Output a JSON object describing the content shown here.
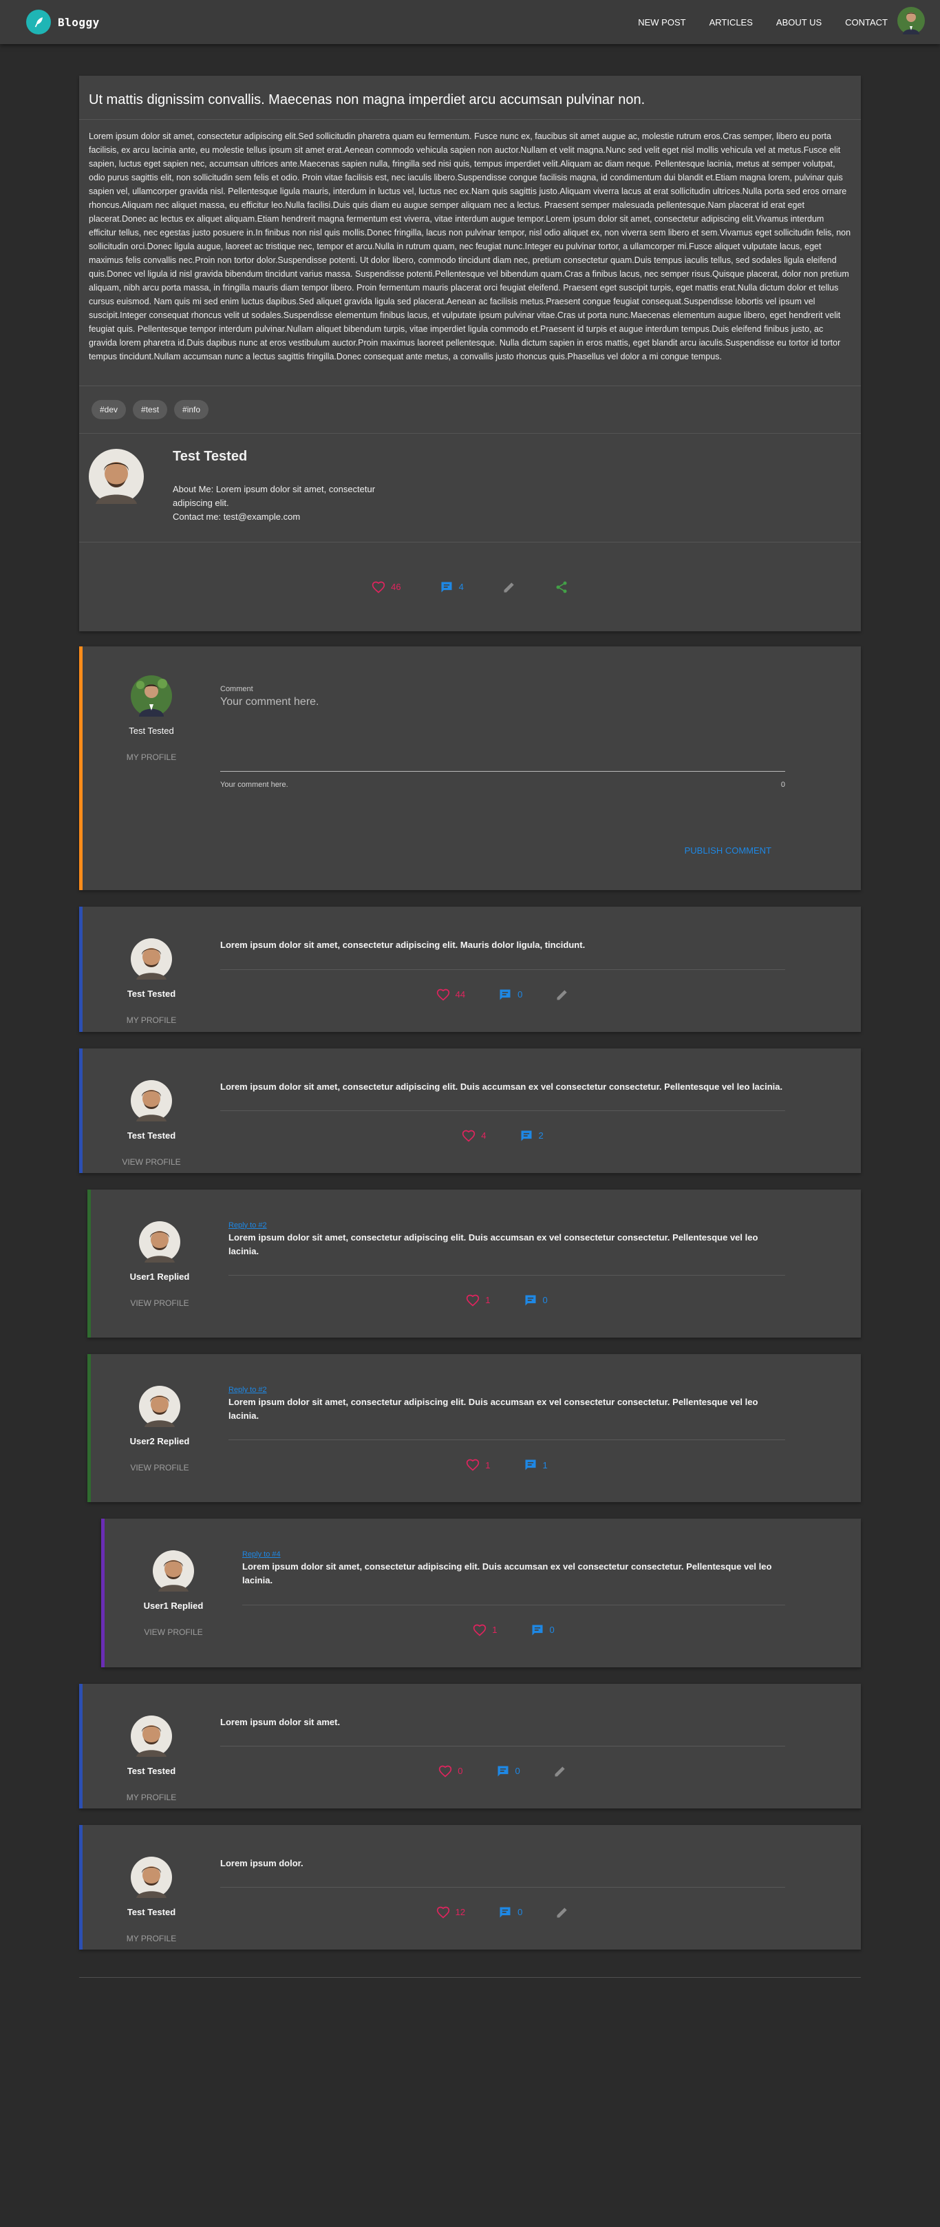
{
  "header": {
    "brand": "Bloggy",
    "nav": [
      "NEW POST",
      "ARTICLES",
      "ABOUT US",
      "CONTACT"
    ]
  },
  "article": {
    "title": "Ut mattis dignissim convallis. Maecenas non magna imperdiet arcu accumsan pulvinar non.",
    "body": "Lorem ipsum dolor sit amet, consectetur adipiscing elit.Sed sollicitudin pharetra quam eu fermentum. Fusce nunc ex, faucibus sit amet augue ac, molestie rutrum eros.Cras semper, libero eu porta facilisis, ex arcu lacinia ante, eu molestie tellus ipsum sit amet erat.Aenean commodo vehicula sapien non auctor.Nullam et velit magna.Nunc sed velit eget nisl mollis vehicula vel at metus.Fusce elit sapien, luctus eget sapien nec, accumsan ultrices ante.Maecenas sapien nulla, fringilla sed nisi quis, tempus imperdiet velit.Aliquam ac diam neque. Pellentesque lacinia, metus at semper volutpat, odio purus sagittis elit, non sollicitudin sem felis et odio. Proin vitae facilisis est, nec iaculis libero.Suspendisse congue facilisis magna, id condimentum dui blandit et.Etiam magna lorem, pulvinar quis sapien vel, ullamcorper gravida nisl. Pellentesque ligula mauris, interdum in luctus vel, luctus nec ex.Nam quis sagittis justo.Aliquam viverra lacus at erat sollicitudin ultrices.Nulla porta sed eros ornare rhoncus.Aliquam nec aliquet massa, eu efficitur leo.Nulla facilisi.Duis quis diam eu augue semper aliquam nec a lectus. Praesent semper malesuada pellentesque.Nam placerat id erat eget placerat.Donec ac lectus ex aliquet aliquam.Etiam hendrerit magna fermentum est viverra, vitae interdum augue tempor.Lorem ipsum dolor sit amet, consectetur adipiscing elit.Vivamus interdum efficitur tellus, nec egestas justo posuere in.In finibus non nisl quis mollis.Donec fringilla, lacus non pulvinar tempor, nisl odio aliquet ex, non viverra sem libero et sem.Vivamus eget sollicitudin felis, non sollicitudin orci.Donec ligula augue, laoreet ac tristique nec, tempor et arcu.Nulla in rutrum quam, nec feugiat nunc.Integer eu pulvinar tortor, a ullamcorper mi.Fusce aliquet vulputate lacus, eget maximus felis convallis nec.Proin non tortor dolor.Suspendisse potenti. Ut dolor libero, commodo tincidunt diam nec, pretium consectetur quam.Duis tempus iaculis tellus, sed sodales ligula eleifend quis.Donec vel ligula id nisl gravida bibendum tincidunt varius massa. Suspendisse potenti.Pellentesque vel bibendum quam.Cras a finibus lacus, nec semper risus.Quisque placerat, dolor non pretium aliquam, nibh arcu porta massa, in fringilla mauris diam tempor libero. Proin fermentum mauris placerat orci feugiat eleifend. Praesent eget suscipit turpis, eget mattis erat.Nulla dictum dolor et tellus cursus euismod. Nam quis mi sed enim luctus dapibus.Sed aliquet gravida ligula sed placerat.Aenean ac facilisis metus.Praesent congue feugiat consequat.Suspendisse lobortis vel ipsum vel suscipit.Integer consequat rhoncus velit ut sodales.Suspendisse elementum finibus lacus, et vulputate ipsum pulvinar vitae.Cras ut porta nunc.Maecenas elementum augue libero, eget hendrerit velit feugiat quis. Pellentesque tempor interdum pulvinar.Nullam aliquet bibendum turpis, vitae imperdiet ligula commodo et.Praesent id turpis et augue interdum tempus.Duis eleifend finibus justo, ac gravida lorem pharetra id.Duis dapibus nunc at eros vestibulum auctor.Proin maximus laoreet pellentesque. Nulla dictum sapien in eros mattis, eget blandit arcu iaculis.Suspendisse eu tortor id tortor tempus tincidunt.Nullam accumsan nunc a lectus sagittis fringilla.Donec consequat ante metus, a convallis justo rhoncus quis.Phasellus vel dolor a mi congue tempus.",
    "tags": [
      "#dev",
      "#test",
      "#info"
    ],
    "author": {
      "name": "Test Tested",
      "about": "About Me: Lorem ipsum dolor sit amet, consectetur adipiscing elit.",
      "contact": "Contact me: test@example.com"
    },
    "likes": "46",
    "comments": "4"
  },
  "comment_form": {
    "user": "Test Tested",
    "profile_link": "MY PROFILE",
    "label": "Comment",
    "placeholder": "Your comment here.",
    "hint": "Your comment here.",
    "counter": "0",
    "publish": "PUBLISH COMMENT"
  },
  "comments": [
    {
      "user": "Test Tested",
      "link": "MY PROFILE",
      "reply_to": "",
      "text": "Lorem ipsum dolor sit amet, consectetur adipiscing elit. Mauris dolor ligula, tincidunt.",
      "likes": "44",
      "replies": "0",
      "editable": true,
      "level": 0
    },
    {
      "user": "Test Tested",
      "link": "VIEW PROFILE",
      "reply_to": "",
      "text": "Lorem ipsum dolor sit amet, consectetur adipiscing elit. Duis accumsan ex vel consectetur consectetur. Pellentesque vel leo lacinia.",
      "likes": "4",
      "replies": "2",
      "editable": false,
      "level": 0
    },
    {
      "user": "User1 Replied",
      "link": "VIEW PROFILE",
      "reply_to": "Reply to #2",
      "text": "Lorem ipsum dolor sit amet, consectetur adipiscing elit. Duis accumsan ex vel consectetur consectetur. Pellentesque vel leo lacinia.",
      "likes": "1",
      "replies": "0",
      "editable": false,
      "level": 1
    },
    {
      "user": "User2 Replied",
      "link": "VIEW PROFILE",
      "reply_to": "Reply to #2",
      "text": "Lorem ipsum dolor sit amet, consectetur adipiscing elit. Duis accumsan ex vel consectetur consectetur. Pellentesque vel leo lacinia.",
      "likes": "1",
      "replies": "1",
      "editable": false,
      "level": 1
    },
    {
      "user": "User1 Replied",
      "link": "VIEW PROFILE",
      "reply_to": "Reply to #4",
      "text": "Lorem ipsum dolor sit amet, consectetur adipiscing elit. Duis accumsan ex vel consectetur consectetur. Pellentesque vel leo lacinia.",
      "likes": "1",
      "replies": "0",
      "editable": false,
      "level": 2
    },
    {
      "user": "Test Tested",
      "link": "MY PROFILE",
      "reply_to": "",
      "text": "Lorem ipsum dolor sit amet.",
      "likes": "0",
      "replies": "0",
      "editable": true,
      "level": 0
    },
    {
      "user": "Test Tested",
      "link": "MY PROFILE",
      "reply_to": "",
      "text": "Lorem ipsum dolor.",
      "likes": "12",
      "replies": "0",
      "editable": true,
      "level": 0
    }
  ],
  "colors": {
    "accent_teal": "#1fb5b5",
    "like_red": "#e0245e",
    "comment_blue": "#1e88e5",
    "share_green": "#43a047",
    "form_border_orange": "#ff8c1a",
    "comment_border_blue": "#2c4fb3",
    "reply_border_green": "#2f6b2f",
    "reply_border_purple": "#6a2db5"
  },
  "icons": [
    "feather-icon",
    "heart-icon",
    "comment-icon",
    "pencil-icon",
    "share-icon",
    "avatar"
  ]
}
